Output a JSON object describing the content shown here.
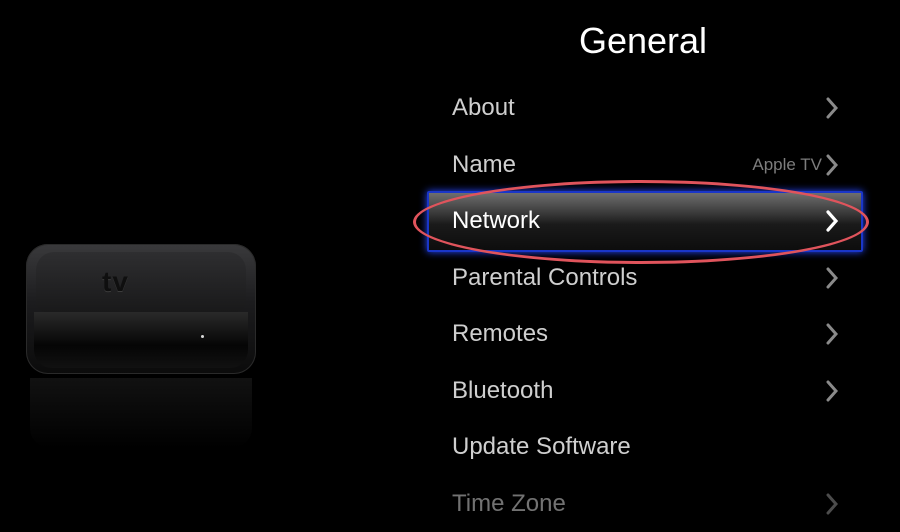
{
  "screen": {
    "title": "General",
    "accent_color": "#1a36c9",
    "annotation_color": "#e0545c"
  },
  "device": {
    "logo_text": "tv",
    "logo_display": "tv"
  },
  "menu": {
    "items": [
      {
        "label": "About",
        "value": "",
        "icon": "chevron-right-icon"
      },
      {
        "label": "Name",
        "value": "Apple TV",
        "icon": "chevron-right-icon"
      },
      {
        "label": "Network",
        "value": "",
        "icon": "chevron-right-icon",
        "selected": true
      },
      {
        "label": "Parental Controls",
        "value": "",
        "icon": "chevron-right-icon"
      },
      {
        "label": "Remotes",
        "value": "",
        "icon": "chevron-right-icon"
      },
      {
        "label": "Bluetooth",
        "value": "",
        "icon": "chevron-right-icon"
      },
      {
        "label": "Update Software",
        "value": "",
        "icon": ""
      },
      {
        "label": "Time Zone",
        "value": "",
        "icon": "chevron-right-icon"
      }
    ]
  }
}
